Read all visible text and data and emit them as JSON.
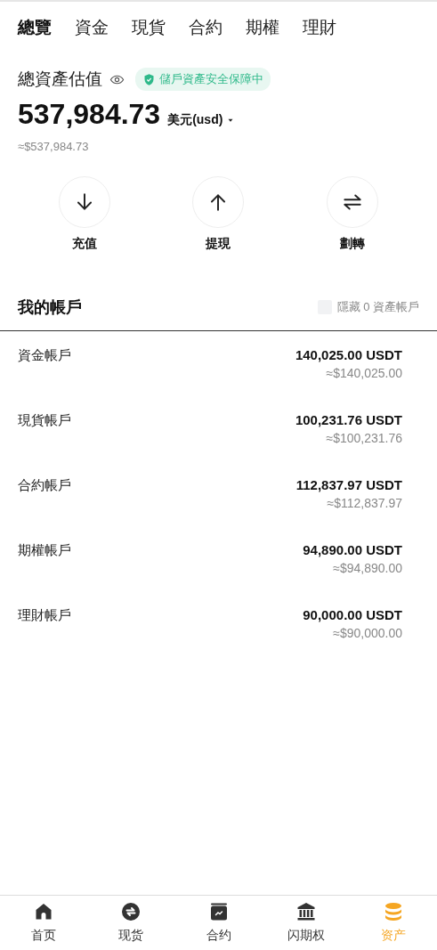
{
  "tabs": [
    {
      "label": "總覽",
      "selected": true
    },
    {
      "label": "資金",
      "selected": false
    },
    {
      "label": "現貨",
      "selected": false
    },
    {
      "label": "合約",
      "selected": false
    },
    {
      "label": "期權",
      "selected": false
    },
    {
      "label": "理財",
      "selected": false
    }
  ],
  "summary": {
    "title": "總資產估值",
    "security_badge": "儲戶資產安全保障中",
    "total": "537,984.73",
    "currency": "美元(usd)",
    "approx": "≈$537,984.73"
  },
  "actions": [
    {
      "kind": "deposit",
      "label": "充值"
    },
    {
      "kind": "withdraw",
      "label": "提現"
    },
    {
      "kind": "transfer",
      "label": "劃轉"
    }
  ],
  "accounts_header": {
    "title": "我的帳戶",
    "hide_zero": {
      "label": "隱藏 0 資產帳戶",
      "checked": false
    }
  },
  "accounts": [
    {
      "name": "資金帳戶",
      "amount": "140,025.00 USDT",
      "approx": "≈$140,025.00"
    },
    {
      "name": "現貨帳戶",
      "amount": "100,231.76 USDT",
      "approx": "≈$100,231.76"
    },
    {
      "name": "合約帳戶",
      "amount": "112,837.97 USDT",
      "approx": "≈$112,837.97"
    },
    {
      "name": "期權帳戶",
      "amount": "94,890.00 USDT",
      "approx": "≈$94,890.00"
    },
    {
      "name": "理財帳戶",
      "amount": "90,000.00 USDT",
      "approx": "≈$90,000.00"
    }
  ],
  "bottom_nav": [
    {
      "kind": "home",
      "label": "首页",
      "selected": false
    },
    {
      "kind": "spot",
      "label": "现货",
      "selected": false
    },
    {
      "kind": "contract",
      "label": "合约",
      "selected": false
    },
    {
      "kind": "options",
      "label": "闪期权",
      "selected": false
    },
    {
      "kind": "assets",
      "label": "资产",
      "selected": true
    }
  ]
}
